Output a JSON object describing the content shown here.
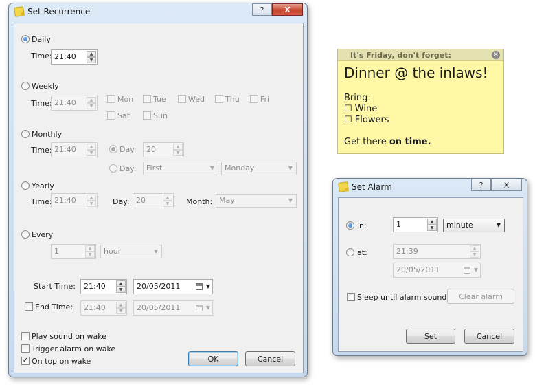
{
  "recurrence": {
    "title": "Set Recurrence",
    "help_glyph": "?",
    "close_glyph": "X",
    "daily": {
      "label": "Daily",
      "time_label": "Time:",
      "time": "21:40",
      "selected": true
    },
    "weekly": {
      "label": "Weekly",
      "time_label": "Time:",
      "time": "21:40",
      "days": [
        "Mon",
        "Tue",
        "Wed",
        "Thu",
        "Fri",
        "Sat",
        "Sun"
      ]
    },
    "monthly": {
      "label": "Monthly",
      "time_label": "Time:",
      "time": "21:40",
      "day_label": "Day:",
      "day_value": "20",
      "day2_label": "Day:",
      "ordinal": "First",
      "weekday": "Monday"
    },
    "yearly": {
      "label": "Yearly",
      "time_label": "Time:",
      "time": "21:40",
      "day_label": "Day:",
      "day_value": "20",
      "month_label": "Month:",
      "month_value": "May"
    },
    "every": {
      "label": "Every",
      "amount": "1",
      "unit": "hour"
    },
    "start": {
      "label": "Start Time:",
      "time": "21:40",
      "date": "20/05/2011"
    },
    "end": {
      "label": "End Time:",
      "time": "21:40",
      "date": "20/05/2011",
      "checked": false
    },
    "options": {
      "play_sound": "Play sound on wake",
      "trigger_alarm": "Trigger alarm on wake",
      "on_top": "On top on wake",
      "on_top_checked": true
    },
    "ok_label": "OK",
    "cancel_label": "Cancel"
  },
  "note": {
    "header": "It's Friday, don't forget:",
    "close_glyph": "✕",
    "heading": "Dinner @ the inlaws!",
    "bring": "Bring:",
    "items": [
      "☐ Wine",
      "☐ Flowers"
    ],
    "footer_prefix": "Get there ",
    "footer_bold": "on time."
  },
  "alarm": {
    "title": "Set Alarm",
    "help_glyph": "?",
    "close_glyph": "X",
    "in_label": "in:",
    "in_value": "1",
    "unit": "minute",
    "at_label": "at:",
    "at_time": "21:39",
    "at_date": "20/05/2011",
    "sleep_label": "Sleep until alarm sounds",
    "clear_label": "Clear alarm",
    "set_label": "Set",
    "cancel_label": "Cancel"
  }
}
